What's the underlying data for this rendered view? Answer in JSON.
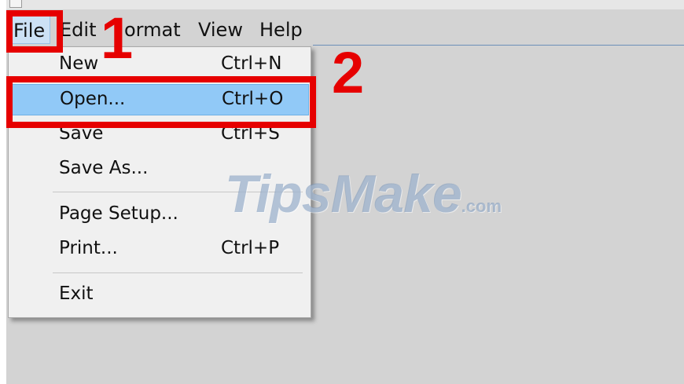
{
  "menubar": {
    "items": [
      {
        "label": "File"
      },
      {
        "label": "Edit"
      },
      {
        "label": "ormat"
      },
      {
        "label": "View"
      },
      {
        "label": "Help"
      }
    ]
  },
  "file_menu": {
    "items": [
      {
        "label": "New",
        "shortcut": "Ctrl+N"
      },
      {
        "label": "Open...",
        "shortcut": "Ctrl+O",
        "highlighted": true
      },
      {
        "label": "Save",
        "shortcut": "Ctrl+S"
      },
      {
        "label": "Save As...",
        "shortcut": ""
      },
      {
        "label": "Page Setup...",
        "shortcut": ""
      },
      {
        "label": "Print...",
        "shortcut": "Ctrl+P"
      },
      {
        "label": "Exit",
        "shortcut": ""
      }
    ]
  },
  "callouts": {
    "step1": "1",
    "step2": "2"
  },
  "watermark": {
    "brand": "TipsMake",
    "suffix": ".com"
  },
  "colors": {
    "callout_red": "#e60000",
    "highlight_blue": "#91c9f7",
    "background_gray": "#d3d3d3"
  }
}
